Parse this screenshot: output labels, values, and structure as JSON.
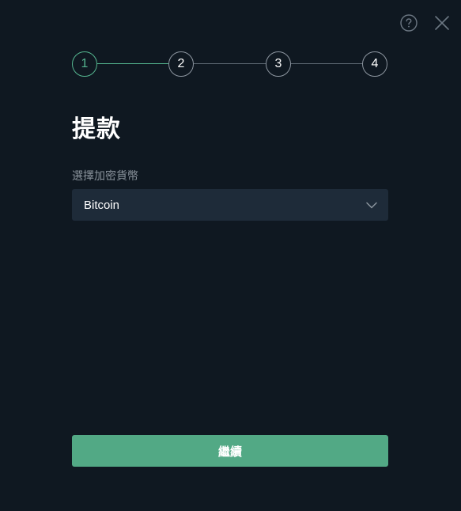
{
  "header": {
    "help_icon": "question-circle-icon",
    "close_icon": "close-icon"
  },
  "stepper": {
    "steps": [
      {
        "label": "1",
        "active": true
      },
      {
        "label": "2",
        "active": false
      },
      {
        "label": "3",
        "active": false
      },
      {
        "label": "4",
        "active": false
      }
    ],
    "current_step": 1
  },
  "page": {
    "title": "提款"
  },
  "currency_field": {
    "label": "選擇加密貨幣",
    "selected_value": "Bitcoin",
    "chevron_icon": "chevron-down-icon"
  },
  "actions": {
    "continue_label": "繼續"
  },
  "colors": {
    "background": "#0f1821",
    "accent": "#55b690",
    "button": "#52a985",
    "select_bg": "#1e2b39",
    "label": "#8a939c"
  }
}
